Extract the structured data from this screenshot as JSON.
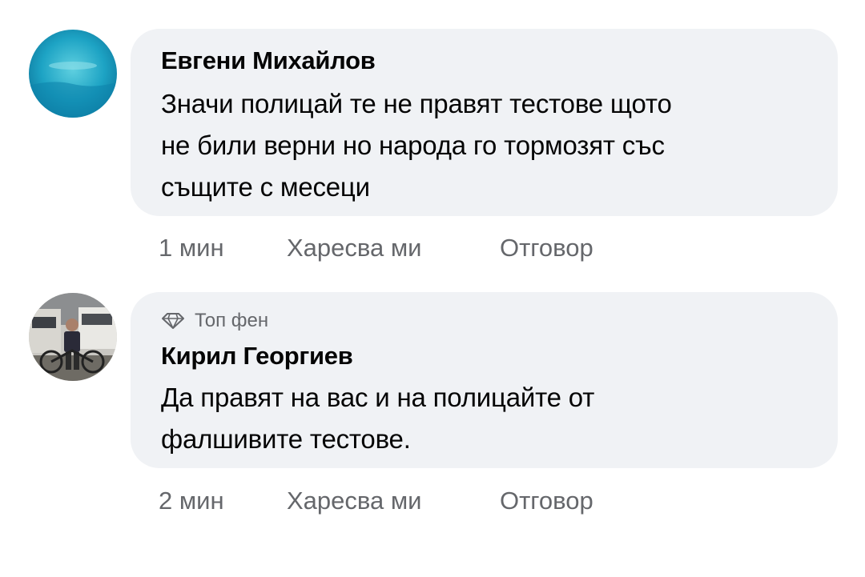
{
  "comments": [
    {
      "author": "Евгени Михайлов",
      "text": "Значи полицай те не правят тестове щото\nне били верни но народа го тормозят със\nсъщите с месеци",
      "time": "1 мин",
      "like_label": "Харесва ми",
      "reply_label": "Отговор",
      "avatar_icon": "ocean-avatar"
    },
    {
      "badge": "Топ фен",
      "badge_icon": "diamond-icon",
      "author": "Кирил Георгиев",
      "text": "Да правят на вас и на полицайте от\nфалшивите тестове.",
      "time": "2 мин",
      "like_label": "Харесва ми",
      "reply_label": "Отговор",
      "avatar_icon": "person-photo-avatar"
    }
  ]
}
